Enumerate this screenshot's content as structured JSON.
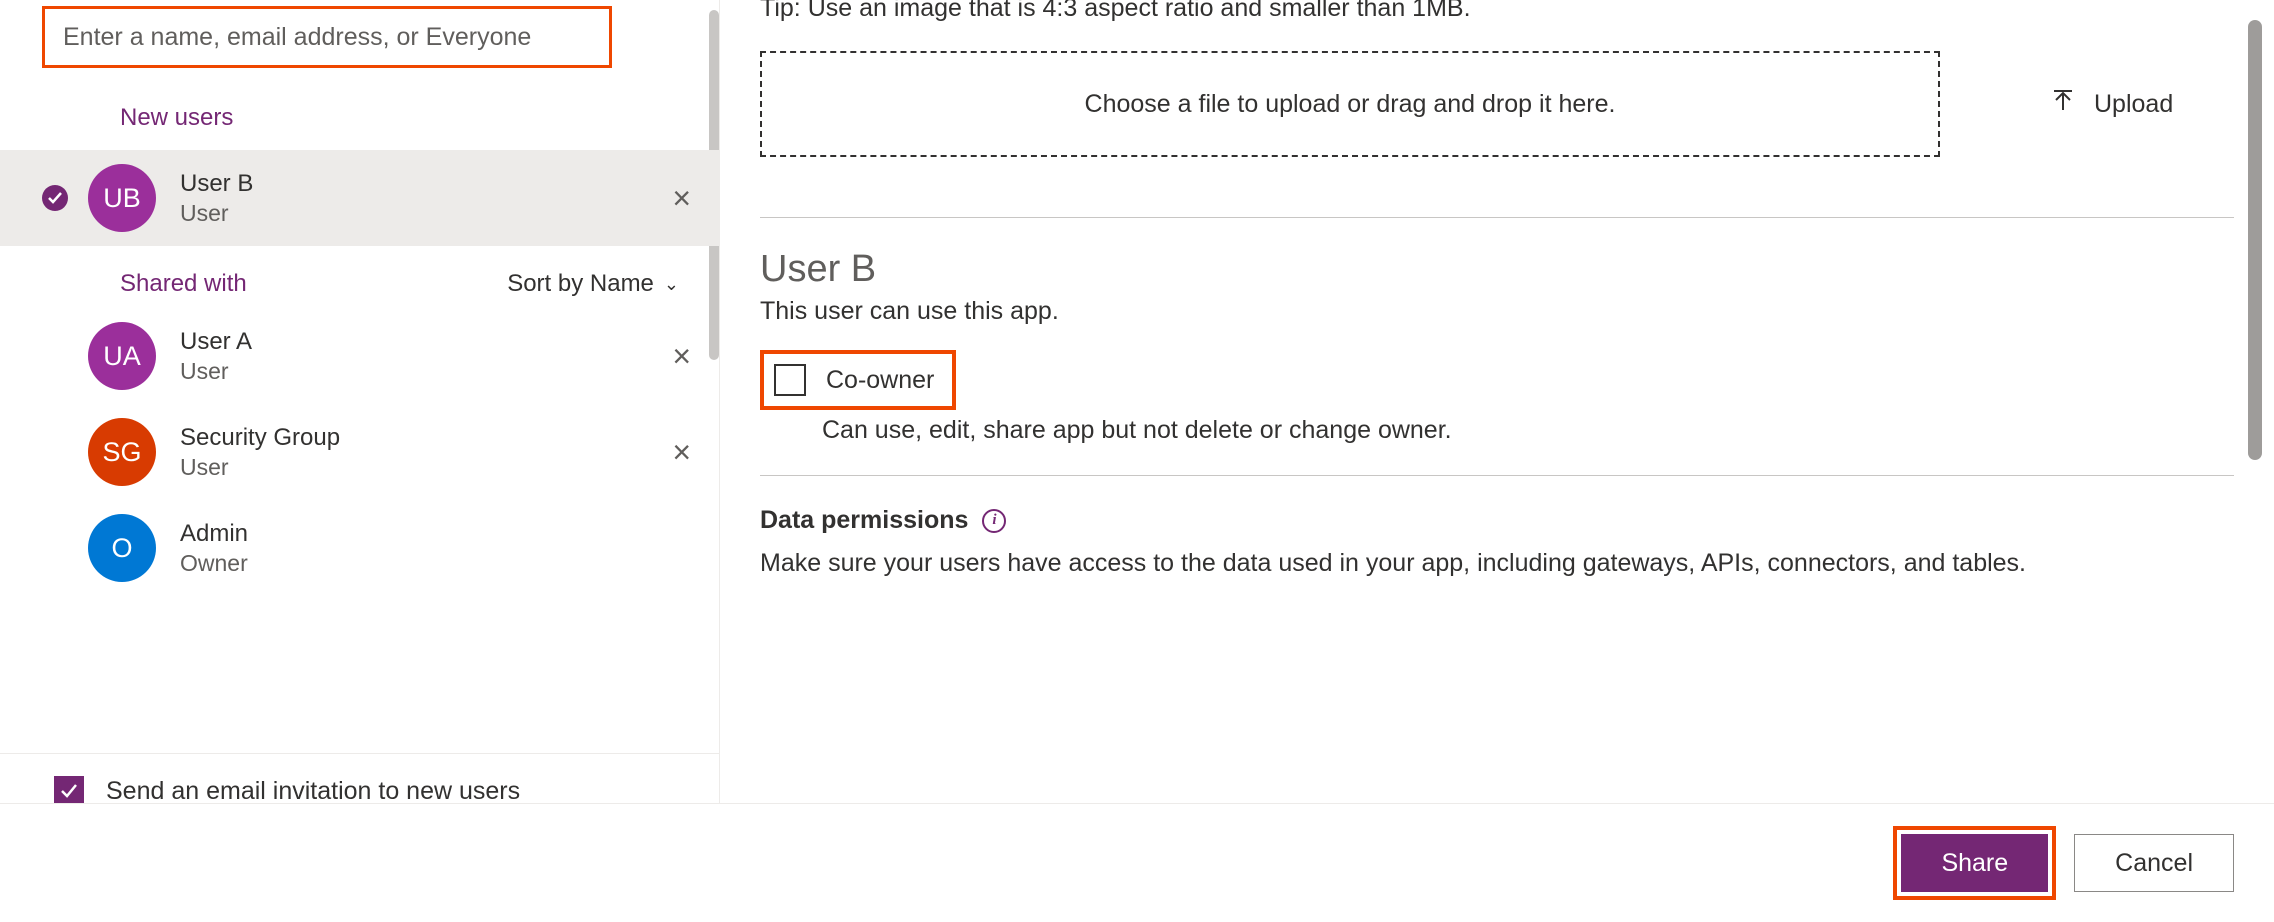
{
  "search": {
    "placeholder": "Enter a name, email address, or Everyone"
  },
  "sections": {
    "new_users": "New users",
    "shared_with": "Shared with",
    "sort_label": "Sort by Name"
  },
  "new_user": {
    "initials": "UB",
    "name": "User B",
    "role": "User"
  },
  "shared_users": [
    {
      "initials": "UA",
      "name": "User A",
      "role": "User",
      "color": "purple",
      "removable": true
    },
    {
      "initials": "SG",
      "name": "Security Group",
      "role": "User",
      "color": "red",
      "removable": true
    },
    {
      "initials": "O",
      "name": "Admin",
      "role": "Owner",
      "color": "blue",
      "removable": false
    }
  ],
  "send_email_label": "Send an email invitation to new users",
  "tip_text": "Tip: Use an image that is 4:3 aspect ratio and smaller than 1MB.",
  "dropzone_text": "Choose a file to upload or drag and drop it here.",
  "upload_label": "Upload",
  "selected_user": {
    "name": "User B",
    "description": "This user can use this app.",
    "coowner_label": "Co-owner",
    "coowner_desc": "Can use, edit, share app but not delete or change owner."
  },
  "data_permissions": {
    "header": "Data permissions",
    "text": "Make sure your users have access to the data used in your app, including gateways, APIs, connectors, and tables."
  },
  "footer": {
    "share": "Share",
    "cancel": "Cancel"
  }
}
